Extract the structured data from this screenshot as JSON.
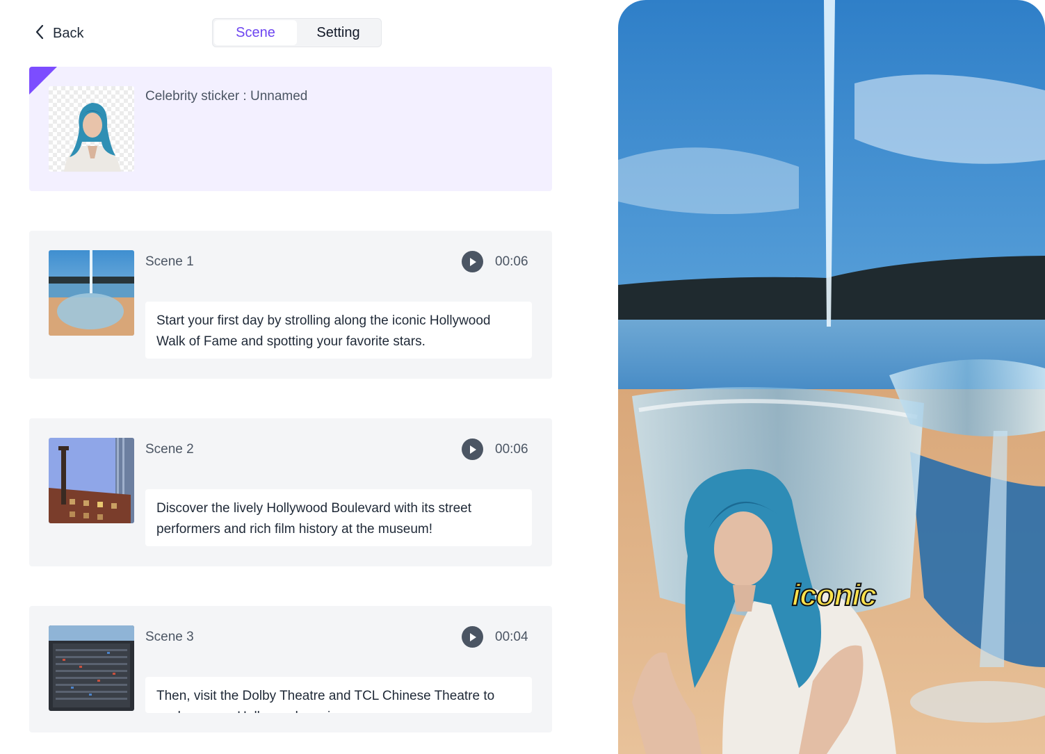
{
  "header": {
    "back_label": "Back",
    "tabs": [
      {
        "label": "Scene",
        "active": true
      },
      {
        "label": "Setting",
        "active": false
      }
    ]
  },
  "sticker": {
    "label": "Celebrity sticker : Unnamed"
  },
  "scenes": [
    {
      "title": "Scene 1",
      "duration": "00:06",
      "text": "Start your first day by strolling along the iconic Hollywood Walk of Fame and spotting your favorite stars."
    },
    {
      "title": "Scene 2",
      "duration": "00:06",
      "text": "Discover the lively Hollywood Boulevard with its street performers and rich film history at the museum!"
    },
    {
      "title": "Scene 3",
      "duration": "00:04",
      "text": "Then, visit the Dolby Theatre and TCL Chinese Theatre to explore more Hollywood magic."
    }
  ],
  "preview": {
    "caption": "iconic"
  },
  "colors": {
    "accent": "#6d45f0",
    "sticker_card_bg": "#f3f0ff",
    "scene_card_bg": "#f4f5f7",
    "caption": "#ffe34d"
  }
}
